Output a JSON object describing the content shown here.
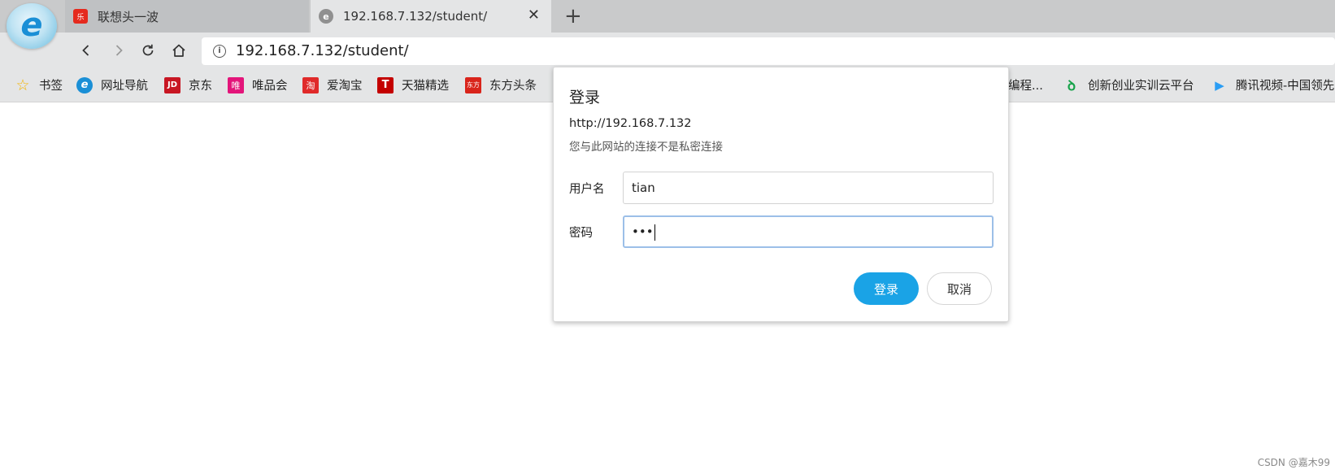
{
  "tabs": [
    {
      "title": "联想头一波",
      "favicon": "lenovo-red-icon",
      "active": false
    },
    {
      "title": "192.168.7.132/student/",
      "favicon": "browser-globe-icon",
      "active": true
    }
  ],
  "toolbar": {
    "url": "192.168.7.132/student/"
  },
  "bookmarks": [
    {
      "label": "书签",
      "icon": "star-icon",
      "color": "#f5b400"
    },
    {
      "label": "网址导航",
      "icon": "ie-icon",
      "color": "#1a8fd6"
    },
    {
      "label": "京东",
      "icon": "jd-icon",
      "icon_text": "JD",
      "color": "#c81623"
    },
    {
      "label": "唯品会",
      "icon": "vip-icon",
      "icon_text": "唯",
      "color": "#e3157a"
    },
    {
      "label": "爱淘宝",
      "icon": "taobao-icon",
      "icon_text": "淘",
      "color": "#e02a2a"
    },
    {
      "label": "天猫精选",
      "icon": "tmall-icon",
      "icon_text": "T",
      "color": "#c40000"
    },
    {
      "label": "东方头条",
      "icon": "dftt-icon",
      "icon_text": "东方",
      "color": "#d9241b"
    },
    {
      "label": "编程...",
      "icon": "",
      "color": "#e4e5e6"
    },
    {
      "label": "创新创业实训云平台",
      "icon": "cloud-icon",
      "color": "#16a34a"
    },
    {
      "label": "腾讯视频-中国领先",
      "icon": "tencent-video-icon",
      "color": "#2a9df4"
    }
  ],
  "dialog": {
    "title": "登录",
    "origin": "http://192.168.7.132",
    "warning": "您与此网站的连接不是私密连接",
    "username_label": "用户名",
    "username_value": "tian",
    "password_label": "密码",
    "password_value": "•••",
    "login_button": "登录",
    "cancel_button": "取消"
  },
  "watermark": "CSDN @嘉木99",
  "colors": {
    "accent": "#1aa3e6",
    "focus_border": "#9cbfe8"
  }
}
